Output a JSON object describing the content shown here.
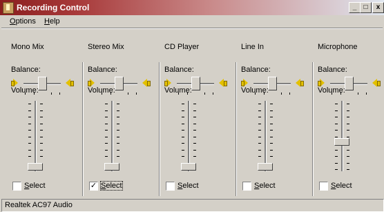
{
  "window": {
    "title": "Recording Control",
    "controls": {
      "minimize": "_",
      "maximize": "□",
      "close": "x"
    }
  },
  "menu": [
    {
      "label": "Options",
      "accel": "O"
    },
    {
      "label": "Help",
      "accel": "H"
    }
  ],
  "channels": [
    {
      "name": "Mono Mix",
      "balance_label": "Balance:",
      "volume_label": "Volume:",
      "volume": 0.0,
      "balance": 0.0,
      "select_label": "Select",
      "selected": false
    },
    {
      "name": "Stereo Mix",
      "balance_label": "Balance:",
      "volume_label": "Volume:",
      "volume": 0.0,
      "balance": 0.0,
      "select_label": "Select",
      "selected": true
    },
    {
      "name": "CD Player",
      "balance_label": "Balance:",
      "volume_label": "Volume:",
      "volume": 0.0,
      "balance": 0.0,
      "select_label": "Select",
      "selected": false
    },
    {
      "name": "Line In",
      "balance_label": "Balance:",
      "volume_label": "Volume:",
      "volume": 0.0,
      "balance": 0.0,
      "select_label": "Select",
      "selected": false
    },
    {
      "name": "Microphone",
      "balance_label": "Balance:",
      "volume_label": "Volume:",
      "volume": 0.4,
      "balance": 0.0,
      "select_label": "Select",
      "selected": false
    }
  ],
  "status_bar": {
    "text": "Realtek AC97 Audio"
  },
  "colors": {
    "titlebar_start": "#8a1e1e",
    "face": "#d4d0c8",
    "speaker": "#e3c000"
  }
}
